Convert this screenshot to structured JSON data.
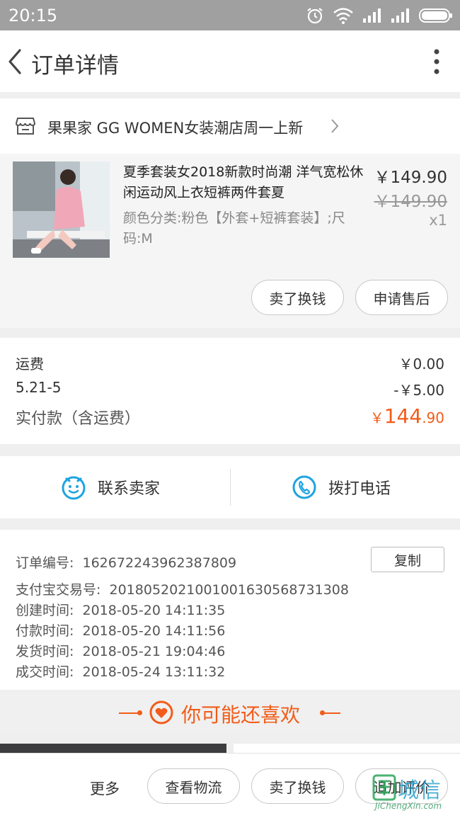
{
  "status_bar": {
    "time": "20:15"
  },
  "header": {
    "title": "订单详情"
  },
  "shop": {
    "name": "果果家  GG WOMEN女装潮店周一上新"
  },
  "product": {
    "title": "夏季套装女2018新款时尚潮 洋气宽松休闲运动风上衣短裤两件套夏",
    "sku": "颜色分类:粉色【外套+短裤套装】;尺码:M",
    "price": "￥149.90",
    "original_price": "￥149.90",
    "quantity": "x1",
    "buttons": {
      "sell": "卖了换钱",
      "after_sale": "申请售后"
    }
  },
  "fees": {
    "shipping_label": "运费",
    "shipping_value": "￥0.00",
    "discount_label": "5.21-5",
    "discount_value": "-￥5.00",
    "paid_label": "实付款（含运费）",
    "paid_currency": "￥",
    "paid_integer": "144",
    "paid_decimal": ".90",
    "accent_color": "#f25c19"
  },
  "contact": {
    "seller": "联系卖家",
    "phone": "拨打电话",
    "icon_color": "#1ea4e0"
  },
  "order_info": {
    "copy_button": "复制",
    "rows": [
      {
        "label": "订单编号:",
        "value": "162672243962387809"
      },
      {
        "label": "支付宝交易号:",
        "value": "2018052021001001630568731308"
      },
      {
        "label": "创建时间:",
        "value": "2018-05-20 14:11:35"
      },
      {
        "label": "付款时间:",
        "value": "2018-05-20 14:11:56"
      },
      {
        "label": "发货时间:",
        "value": "2018-05-21 19:04:46"
      },
      {
        "label": "成交时间:",
        "value": "2018-05-24 13:11:32"
      }
    ]
  },
  "recommend": {
    "title": "你可能还喜欢"
  },
  "bottom_bar": {
    "more": "更多",
    "logistics": "查看物流",
    "sell": "卖了换钱",
    "review": "追加评价"
  },
  "watermark": {
    "cn": "城信",
    "en": "JiChengXin.com"
  }
}
